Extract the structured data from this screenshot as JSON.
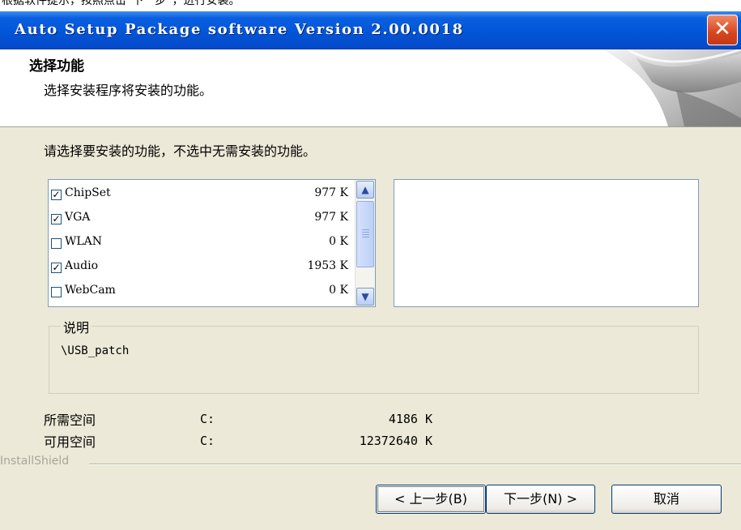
{
  "top_note": "根据软件提示，按照点击“下一步”，进行安装。",
  "window": {
    "title": "Auto Setup Package software Version 2.00.0018",
    "close_glyph": "✕"
  },
  "header": {
    "title": "选择功能",
    "subtitle": "选择安装程序将安装的功能。"
  },
  "instruction": "请选择要安装的功能，不选中无需安装的功能。",
  "features": [
    {
      "name": "ChipSet",
      "size": "977 K",
      "checked": true
    },
    {
      "name": "VGA",
      "size": "977 K",
      "checked": true
    },
    {
      "name": "WLAN",
      "size": "0 K",
      "checked": false
    },
    {
      "name": "Audio",
      "size": "1953 K",
      "checked": true
    },
    {
      "name": "WebCam",
      "size": "0 K",
      "checked": false
    }
  ],
  "description": {
    "label": "说明",
    "text": "\\USB_patch"
  },
  "space": {
    "required_label": "所需空间",
    "required_drive": "C:",
    "required_value": "4186 K",
    "available_label": "可用空间",
    "available_drive": "C:",
    "available_value": "12372640 K"
  },
  "brand": "InstallShield",
  "buttons": {
    "back": "< 上一步(B)",
    "next": "下一步(N) >",
    "cancel": "取消"
  },
  "colors": {
    "titlebar": "#0256d8",
    "close_button": "#d9441d",
    "dialog_background": "#ece9d8"
  }
}
